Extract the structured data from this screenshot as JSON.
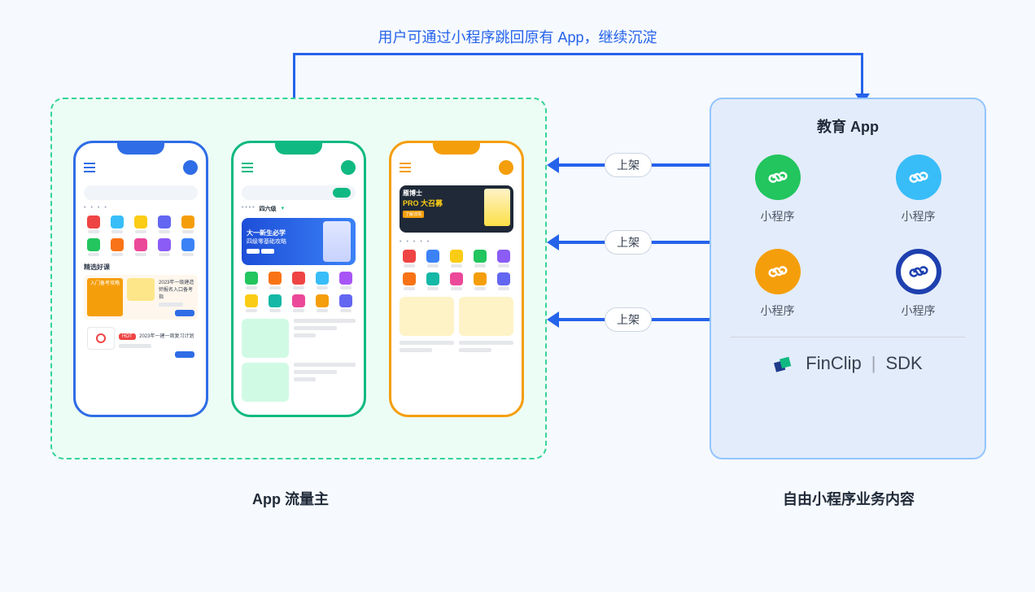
{
  "top_text": "用户可通过小程序跳回原有 App，继续沉淀",
  "arrows": {
    "label": "上架"
  },
  "left": {
    "caption": "App 流量主"
  },
  "right": {
    "title": "教育 App",
    "caption": "自由小程序业务内容",
    "items": [
      {
        "label": "小程序",
        "color": "#22c55e"
      },
      {
        "label": "小程序",
        "color": "#38bdf8"
      },
      {
        "label": "小程序",
        "color": "#f59e0b"
      },
      {
        "label": "小程序",
        "color": "#1e40af"
      }
    ],
    "sdk": {
      "brand": "FinClip",
      "suffix": "SDK"
    }
  },
  "phones": {
    "p1": {
      "banner_bg": "#fde68a",
      "banner_text": "入门备考攻略",
      "section": "精选好课",
      "card1_tag": "2023年一级建造师报名入口备考指",
      "pill_bg": "#f59e0b",
      "card2_tag": "2023年一建一周复习计划",
      "pill2_bg": "#ef4444",
      "icon_colors": [
        "#ef4444",
        "#38bdf8",
        "#facc15",
        "#6366f1",
        "#f59e0b",
        "#22c55e",
        "#f97316",
        "#ec4899",
        "#8b5cf6",
        "#3b82f6"
      ]
    },
    "p2": {
      "tab_active": "四六级",
      "banner_line1": "大一新生必学",
      "banner_line2": "四级零基础攻略",
      "icon_colors": [
        "#22c55e",
        "#f97316",
        "#ef4444",
        "#38bdf8",
        "#a855f7",
        "#facc15",
        "#14b8a6",
        "#ec4899",
        "#f59e0b",
        "#6366f1"
      ]
    },
    "p3": {
      "banner_title1": "雁博士",
      "banner_title2": "PRO 大召募",
      "banner_btn": "了解详情",
      "icon_colors": [
        "#ef4444",
        "#3b82f6",
        "#facc15",
        "#22c55e",
        "#8b5cf6",
        "#f97316",
        "#14b8a6",
        "#ec4899",
        "#f59e0b",
        "#6366f1"
      ]
    }
  }
}
